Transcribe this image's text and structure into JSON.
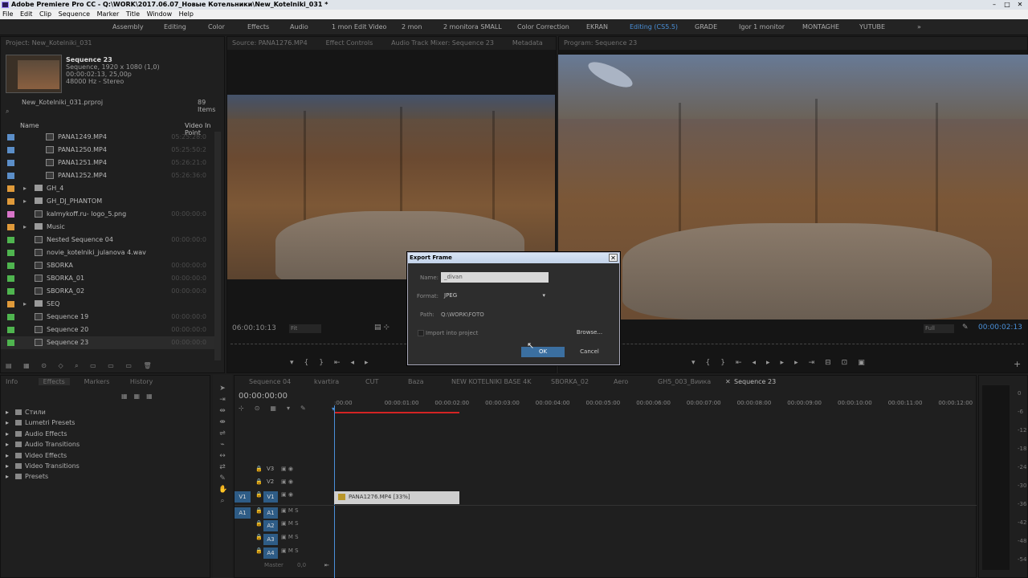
{
  "titlebar": {
    "title": "Adobe Premiere Pro CC - Q:\\WORK\\2017.06.07_Новые Котельники\\New_Kotelniki_031 *"
  },
  "menu": [
    "File",
    "Edit",
    "Clip",
    "Sequence",
    "Marker",
    "Title",
    "Window",
    "Help"
  ],
  "workspaces": [
    "Assembly",
    "Editing",
    "Color",
    "Effects",
    "Audio",
    "1 mon Edit Video",
    "2 mon",
    "2 monitora SMALL",
    "Color Correction",
    "EKRAN",
    "Editing (CS5.5)",
    "GRADE",
    "Igor 1 monitor",
    "MONTAGHE",
    "YUTUBE"
  ],
  "project": {
    "tab": "Project: New_Kotelniki_031",
    "seq_name": "Sequence 23",
    "seq_info": [
      "Sequence, 1920 x 1080 (1,0)",
      "00:00:02:13, 25,00p",
      "48000 Hz - Stereo"
    ],
    "file": "New_Kotelniki_031.prproj",
    "count": "89 Items",
    "col_name": "Name",
    "col_vin": "Video In Point",
    "items": [
      {
        "name": "PANA1249.MP4",
        "color": "#5b8ec8",
        "val": "05:25:28:0",
        "type": "clip",
        "indent": 2
      },
      {
        "name": "PANA1250.MP4",
        "color": "#5b8ec8",
        "val": "05:25:50:2",
        "type": "clip",
        "indent": 2
      },
      {
        "name": "PANA1251.MP4",
        "color": "#5b8ec8",
        "val": "05:26:21:0",
        "type": "clip",
        "indent": 2
      },
      {
        "name": "PANA1252.MP4",
        "color": "#5b8ec8",
        "val": "05:26:36:0",
        "type": "clip",
        "indent": 2
      },
      {
        "name": "GH_4",
        "color": "#e09a3a",
        "val": "",
        "type": "folder",
        "indent": 1
      },
      {
        "name": "GH_DJ_PHANTOM",
        "color": "#e09a3a",
        "val": "",
        "type": "folder",
        "indent": 1
      },
      {
        "name": "kalmykoff.ru- logo_5.png",
        "color": "#d874c8",
        "val": "00:00:00:0",
        "type": "img",
        "indent": 1
      },
      {
        "name": "Music",
        "color": "#e09a3a",
        "val": "",
        "type": "folder",
        "indent": 1
      },
      {
        "name": "Nested Sequence 04",
        "color": "#4fb54f",
        "val": "00:00:00:0",
        "type": "seq",
        "indent": 1
      },
      {
        "name": "novie_kotelniki_julanova 4.wav",
        "color": "#4fb54f",
        "val": "",
        "type": "audio",
        "indent": 1
      },
      {
        "name": "SBORKA",
        "color": "#4fb54f",
        "val": "00:00:00:0",
        "type": "seq",
        "indent": 1
      },
      {
        "name": "SBORKA_01",
        "color": "#4fb54f",
        "val": "00:00:00:0",
        "type": "seq",
        "indent": 1
      },
      {
        "name": "SBORKA_02",
        "color": "#4fb54f",
        "val": "00:00:00:0",
        "type": "seq",
        "indent": 1
      },
      {
        "name": "SEQ",
        "color": "#e09a3a",
        "val": "",
        "type": "folder",
        "indent": 1
      },
      {
        "name": "Sequence 19",
        "color": "#4fb54f",
        "val": "00:00:00:0",
        "type": "seq",
        "indent": 1
      },
      {
        "name": "Sequence 20",
        "color": "#4fb54f",
        "val": "00:00:00:0",
        "type": "seq",
        "indent": 1
      },
      {
        "name": "Sequence 23",
        "color": "#4fb54f",
        "val": "00:00:00:0",
        "type": "seq",
        "indent": 1
      }
    ]
  },
  "source": {
    "tabs": [
      "Source: PANA1276.MP4",
      "Effect Controls",
      "Audio Track Mixer: Sequence 23",
      "Metadata"
    ],
    "timecode": "06:00:10:13",
    "fit": "Fit"
  },
  "program": {
    "tab": "Program: Sequence 23",
    "fit": "Full",
    "timecode": "00:00:02:13"
  },
  "effects": {
    "tabs": [
      "Info",
      "Effects",
      "Markers",
      "History"
    ],
    "tree": [
      "Стили",
      "Lumetri Presets",
      "Audio Effects",
      "Audio Transitions",
      "Video Effects",
      "Video Transitions",
      "Presets"
    ]
  },
  "timeline": {
    "tabs": [
      "Sequence 04",
      "kvartira",
      "CUT",
      "Baza",
      "NEW KOTELNIKI BASE 4K",
      "SBORKA_02",
      "Aero",
      "GH5_003_Виика",
      "Sequence 23"
    ],
    "timecode": "00:00:00:00",
    "ticks": [
      ":00:00",
      "00:00:01:00",
      "00:00:02:00",
      "00:00:03:00",
      "00:00:04:00",
      "00:00:05:00",
      "00:00:06:00",
      "00:00:07:00",
      "00:00:08:00",
      "00:00:09:00",
      "00:00:10:00",
      "00:00:11:00",
      "00:00:12:00"
    ],
    "video_tracks": [
      "V3",
      "V2",
      "V1"
    ],
    "audio_tracks": [
      "A1",
      "A2",
      "A3",
      "A4"
    ],
    "master": "Master",
    "master_val": "0,0",
    "clip": "PANA1276.MP4 [33%]"
  },
  "meter": [
    "0",
    "-6",
    "-12",
    "-18",
    "-24",
    "-30",
    "-36",
    "-42",
    "-48",
    "-54"
  ],
  "dialog": {
    "title": "Export Frame",
    "name_label": "Name:",
    "name_value": "_divan",
    "format_label": "Format:",
    "format_value": "JPEG",
    "path_label": "Path:",
    "path_value": "Q:\\WORK\\FOTO",
    "import_label": "Import into project",
    "browse": "Browse...",
    "ok": "OK",
    "cancel": "Cancel"
  }
}
